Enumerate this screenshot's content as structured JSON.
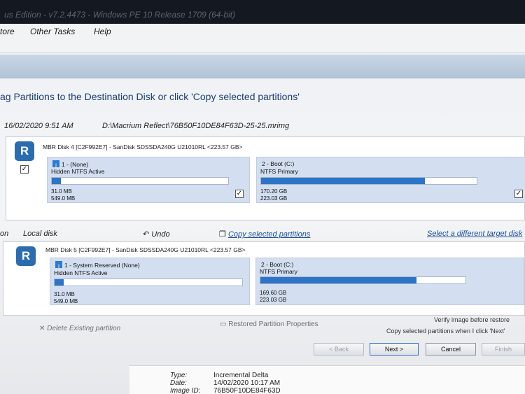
{
  "window": {
    "title": "us Edition - v7.2.4473 - Windows PE 10 Release 1709 (64-bit)"
  },
  "menu": {
    "items": [
      "tore",
      "Other Tasks",
      "Help"
    ]
  },
  "instruction": "ag Partitions to the Destination Disk or click 'Copy selected partitions'",
  "image_info": {
    "date": "16/02/2020 9:51 AM",
    "path": "D:\\Macrium Reflect\\76B50F10DE84F63D-25-25.mrimg"
  },
  "source_disk": {
    "label": "MBR Disk 4 [C2F992E7] - SanDisk SDSSDA240G U21010RL  <223.57 GB>",
    "partitions": [
      {
        "title": "1 - (None)",
        "type": "Hidden NTFS Active",
        "used": "31.0 MB",
        "total": "549.0 MB",
        "fill": 0.05
      },
      {
        "title": "2 - Boot (C:)",
        "type": "NTFS Primary",
        "used": "170.20 GB",
        "total": "223.03 GB",
        "fill": 0.76
      }
    ]
  },
  "actions": {
    "section_prefix": "on",
    "local_disk": "Local disk",
    "undo": "Undo",
    "copy_selected": "Copy selected partitions",
    "select_target": "Select a different target disk"
  },
  "dest_disk": {
    "label": "MBR Disk 5 [C2F992E7] - SanDisk SDSSDA240G U21010RL  <223.57 GB>",
    "partitions": [
      {
        "title": "1 - System Reserved (None)",
        "type": "Hidden NTFS Active",
        "used": "31.0 MB",
        "total": "549.0 MB",
        "fill": 0.05
      },
      {
        "title": "2 - Boot (C:)",
        "type": "NTFS Primary",
        "used": "169.60 GB",
        "total": "223.03 GB",
        "fill": 0.76
      }
    ]
  },
  "bottom": {
    "delete_partition": "Delete Existing partition",
    "restored_props": "Restored Partition Properties",
    "verify": "Verify image before restore",
    "copy_on_next": "Copy selected partitions when I click 'Next'"
  },
  "buttons": {
    "back": "< Back",
    "next": "Next >",
    "cancel": "Cancel",
    "finish": "Finish"
  },
  "details": {
    "type_label": "Type:",
    "type_value": "Incremental Delta",
    "date_label": "Date:",
    "date_value": "14/02/2020 10:17 AM",
    "id_label": "Image ID:",
    "id_value": "76B50F10DE84F63D"
  }
}
